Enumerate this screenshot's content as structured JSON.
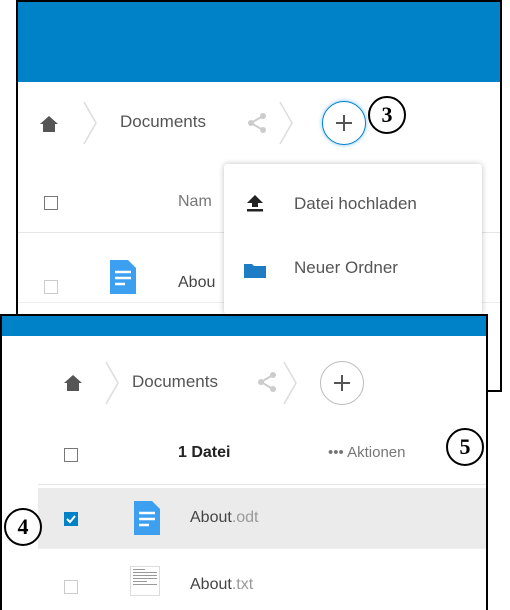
{
  "top_view": {
    "breadcrumb": {
      "folder": "Documents"
    },
    "table": {
      "name_header": "Nam"
    },
    "files": [
      {
        "name": "Abou"
      }
    ],
    "new_menu": {
      "items": [
        {
          "label": "Datei hochladen",
          "icon": "upload-icon"
        },
        {
          "label": "Neuer Ordner",
          "icon": "folder-icon"
        }
      ]
    },
    "callout": "3"
  },
  "bottom_view": {
    "breadcrumb": {
      "folder": "Documents"
    },
    "table": {
      "selection_count": "1 Datei",
      "actions_label": "••• Aktionen"
    },
    "files": [
      {
        "base": "About",
        "ext": ".odt",
        "selected": true
      },
      {
        "base": "About",
        "ext": ".txt",
        "selected": false
      }
    ],
    "callout_left": "4",
    "callout_right": "5"
  },
  "colors": {
    "brand": "#0082c9",
    "doc_icon": "#3c9ff0",
    "folder": "#1d7cc4"
  }
}
